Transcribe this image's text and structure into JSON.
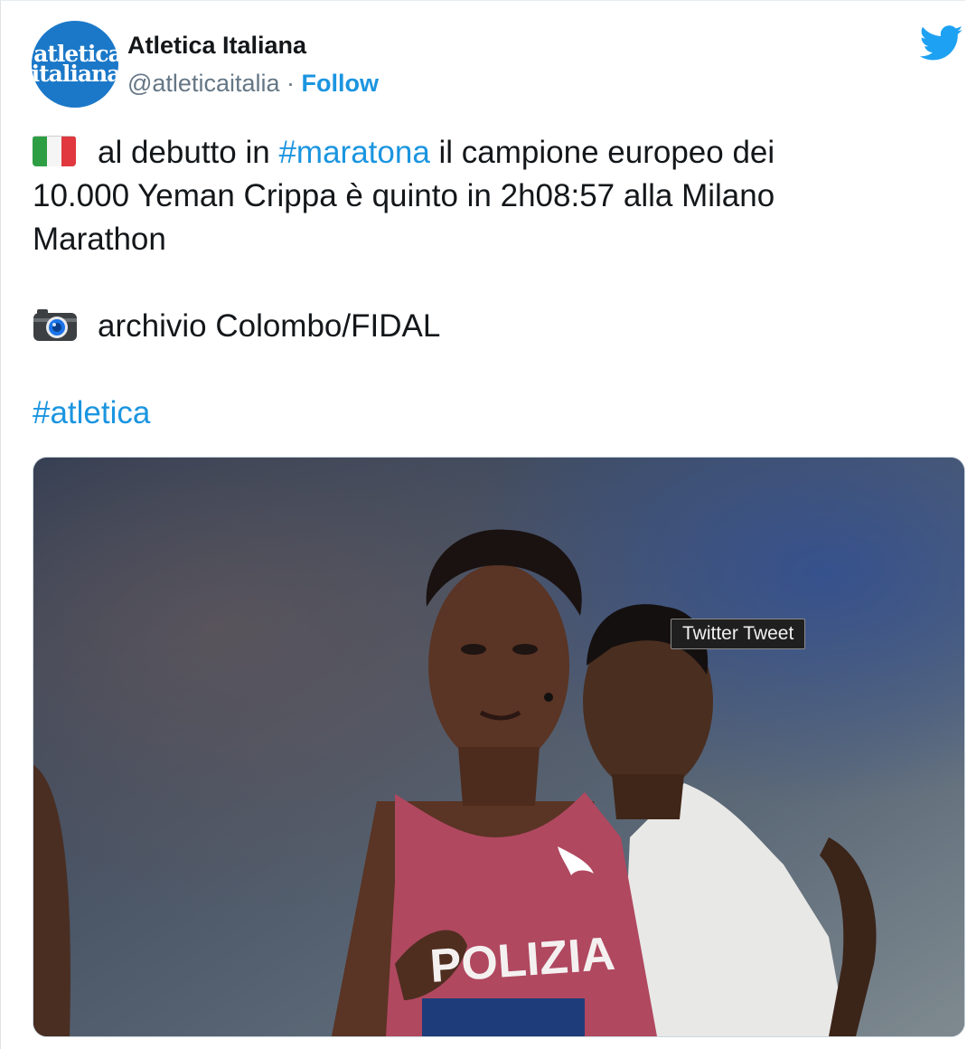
{
  "tweet": {
    "avatar": {
      "line1": "atletica",
      "line2": "italiana",
      "bg_color": "#1b78c8"
    },
    "author_name": "Atletica Italiana",
    "handle": "@atleticaitalia",
    "separator": "·",
    "follow_label": "Follow",
    "brand_icon": "twitter-bird-icon",
    "text": {
      "flag_icon": "italy-flag-icon",
      "line1_prefix": "al debutto in",
      "hashtag1": "#maratona",
      "line1_suffix": "il campione europeo dei",
      "line2": "10.000 Yeman Crippa è quinto in 2h08:57 alla Milano",
      "line3": "Marathon",
      "camera_icon": "camera-icon",
      "credit": "archivio Colombo/FIDAL",
      "hashtag2": "#atletica"
    },
    "photo": {
      "bib_text": "POLIZIA"
    },
    "tooltip": "Twitter Tweet"
  },
  "colors": {
    "link": "#1b95e0",
    "text": "#14171a",
    "secondary": "#657786",
    "jersey": "#b04860"
  }
}
